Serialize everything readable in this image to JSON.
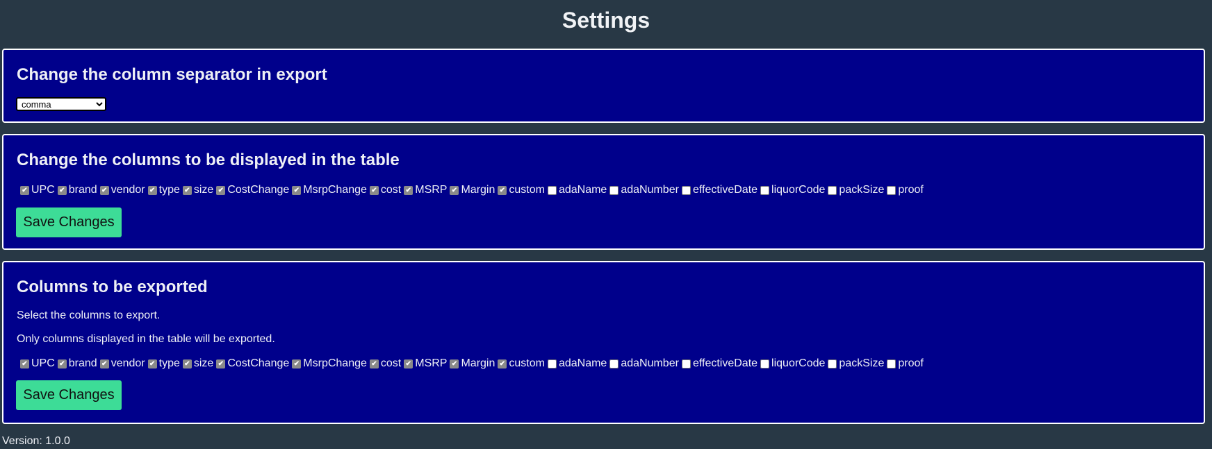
{
  "page": {
    "title": "Settings"
  },
  "separator": {
    "heading": "Change the column separator in export",
    "selected": "comma"
  },
  "display_columns": {
    "heading": "Change the columns to be displayed in the table",
    "columns": [
      {
        "label": "UPC",
        "checked": true
      },
      {
        "label": "brand",
        "checked": true
      },
      {
        "label": "vendor",
        "checked": true
      },
      {
        "label": "type",
        "checked": true
      },
      {
        "label": "size",
        "checked": true
      },
      {
        "label": "CostChange",
        "checked": true
      },
      {
        "label": "MsrpChange",
        "checked": true
      },
      {
        "label": "cost",
        "checked": true
      },
      {
        "label": "MSRP",
        "checked": true
      },
      {
        "label": "Margin",
        "checked": true
      },
      {
        "label": "custom",
        "checked": true
      },
      {
        "label": "adaName",
        "checked": false
      },
      {
        "label": "adaNumber",
        "checked": false
      },
      {
        "label": "effectiveDate",
        "checked": false
      },
      {
        "label": "liquorCode",
        "checked": false
      },
      {
        "label": "packSize",
        "checked": false
      },
      {
        "label": "proof",
        "checked": false
      }
    ],
    "save_label": "Save Changes"
  },
  "export_columns": {
    "heading": "Columns to be exported",
    "description_1": "Select the columns to export.",
    "description_2": "Only columns displayed in the table will be exported.",
    "columns": [
      {
        "label": "UPC",
        "checked": true
      },
      {
        "label": "brand",
        "checked": true
      },
      {
        "label": "vendor",
        "checked": true
      },
      {
        "label": "type",
        "checked": true
      },
      {
        "label": "size",
        "checked": true
      },
      {
        "label": "CostChange",
        "checked": true
      },
      {
        "label": "MsrpChange",
        "checked": true
      },
      {
        "label": "cost",
        "checked": true
      },
      {
        "label": "MSRP",
        "checked": true
      },
      {
        "label": "Margin",
        "checked": true
      },
      {
        "label": "custom",
        "checked": true
      },
      {
        "label": "adaName",
        "checked": false
      },
      {
        "label": "adaNumber",
        "checked": false
      },
      {
        "label": "effectiveDate",
        "checked": false
      },
      {
        "label": "liquorCode",
        "checked": false
      },
      {
        "label": "packSize",
        "checked": false
      },
      {
        "label": "proof",
        "checked": false
      }
    ],
    "save_label": "Save Changes"
  },
  "footer": {
    "version": "Version: 1.0.0"
  },
  "colors": {
    "background": "#283845",
    "panel": "#00008b",
    "button": "#3ddc97",
    "checked_box": "#8a8a8a"
  }
}
